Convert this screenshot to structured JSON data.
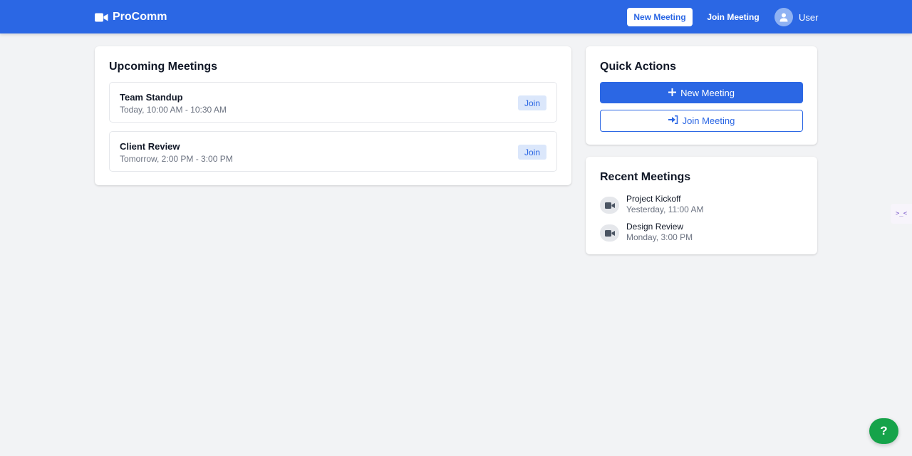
{
  "brand": {
    "name": "ProComm",
    "icon": "video-camera-icon"
  },
  "nav": {
    "new_meeting": "New Meeting",
    "join_meeting": "Join Meeting",
    "user_label": "User",
    "user_icon": "user-avatar-icon"
  },
  "upcoming": {
    "title": "Upcoming Meetings",
    "meetings": [
      {
        "title": "Team Standup",
        "time": "Today, 10:00 AM - 10:30 AM",
        "action": "Join"
      },
      {
        "title": "Client Review",
        "time": "Tomorrow, 2:00 PM - 3:00 PM",
        "action": "Join"
      }
    ]
  },
  "quick_actions": {
    "title": "Quick Actions",
    "new_meeting": "New Meeting",
    "new_meeting_icon": "plus-icon",
    "join_meeting": "Join Meeting",
    "join_meeting_icon": "sign-in-icon"
  },
  "recent": {
    "title": "Recent Meetings",
    "items": [
      {
        "title": "Project Kickoff",
        "time": "Yesterday, 11:00 AM",
        "icon": "video-camera-icon"
      },
      {
        "title": "Design Review",
        "time": "Monday, 3:00 PM",
        "icon": "video-camera-icon"
      }
    ]
  },
  "side_tab": {
    "label": ">_<"
  },
  "help": {
    "label": "?"
  },
  "colors": {
    "primary": "#2b67e4",
    "background": "#f2f3f5",
    "help_button": "#16a34a",
    "join_badge_bg": "#dbe7fb"
  }
}
